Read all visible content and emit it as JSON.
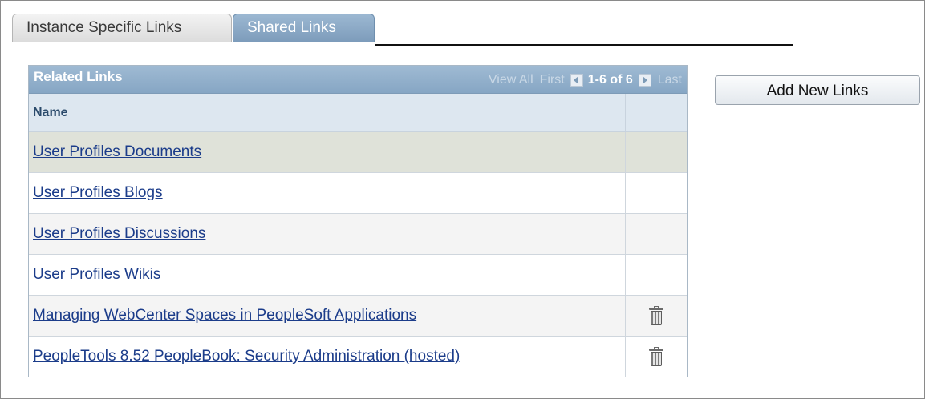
{
  "tabs": {
    "instance_label": "Instance Specific Links",
    "shared_label": "Shared Links"
  },
  "grid": {
    "title": "Related Links",
    "nav": {
      "view_all": "View All",
      "first": "First",
      "range": "1-6 of 6",
      "last": "Last"
    },
    "column_name": "Name",
    "rows": [
      {
        "name": "User Profiles Documents",
        "deletable": false
      },
      {
        "name": "User Profiles Blogs",
        "deletable": false
      },
      {
        "name": "User Profiles Discussions",
        "deletable": false
      },
      {
        "name": "User Profiles Wikis",
        "deletable": false
      },
      {
        "name": "Managing WebCenter Spaces in PeopleSoft Applications",
        "deletable": true,
        "icon": "trash-icon"
      },
      {
        "name": "PeopleTools 8.52 PeopleBook: Security Administration (hosted)",
        "deletable": true,
        "icon": "trash-icon"
      }
    ]
  },
  "actions": {
    "add_new_links": "Add New Links"
  },
  "colors": {
    "active_tab": "#8aa8c6",
    "link": "#1b3c8a",
    "selected_row": "#dfe2d9"
  }
}
